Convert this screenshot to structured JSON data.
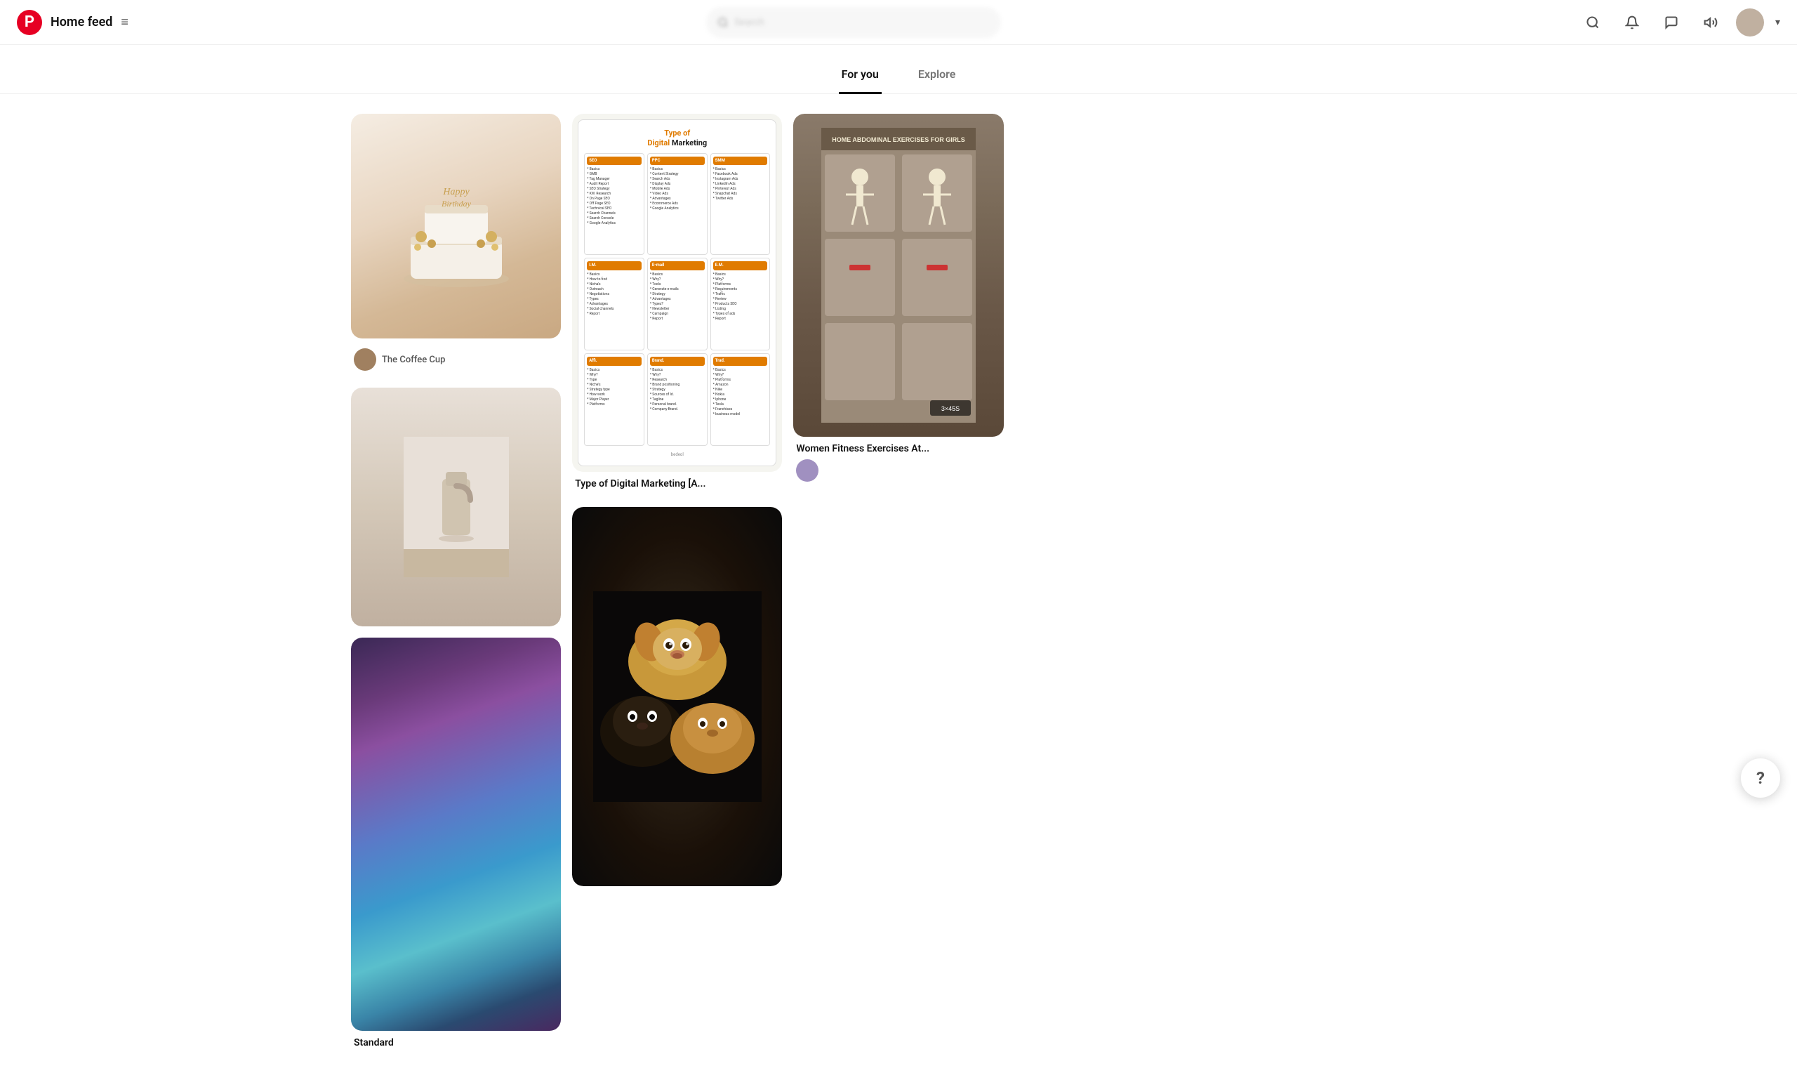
{
  "header": {
    "logo_symbol": "P",
    "title": "Home feed",
    "hamburger": "≡",
    "search_placeholder": "Search",
    "icons": [
      "search",
      "bell",
      "chat",
      "megaphone"
    ],
    "chevron": "▾"
  },
  "tabs": {
    "items": [
      {
        "id": "for-you",
        "label": "For you",
        "active": true
      },
      {
        "id": "explore",
        "label": "Explore",
        "active": false
      }
    ]
  },
  "pins": [
    {
      "id": "cake",
      "title": "",
      "user_name": "The Coffee Cup",
      "has_user": true,
      "col": 0
    },
    {
      "id": "abstract",
      "title": "Standard",
      "user_name": "",
      "has_user": false,
      "col": 1
    },
    {
      "id": "digital-marketing",
      "title": "Type of Digital Marketing [A...",
      "user_name": "",
      "has_user": false,
      "col": 2
    },
    {
      "id": "puppies",
      "title": "",
      "user_name": "",
      "has_user": false,
      "col": 3
    },
    {
      "id": "fitness",
      "title": "Women Fitness Exercises At...",
      "user_name": "",
      "has_user": true,
      "col": 4
    },
    {
      "id": "interior",
      "title": "",
      "user_name": "",
      "has_user": false,
      "col": 0
    }
  ],
  "digital_marketing": {
    "title_line1": "Type of",
    "title_highlight": "Digital",
    "title_line2": "Marketing",
    "cells": [
      {
        "header": "SEO",
        "items": [
          "Basics",
          "GMB",
          "Tag Manager",
          "Audit Report",
          "SEO Strategy",
          "KW. Research",
          "On Page SEO",
          "Off Page SEO",
          "Technical SEO",
          "Search Channels",
          "Search Console",
          "Google Analytics"
        ]
      },
      {
        "header": "PPC",
        "items": [
          "Basics",
          "Content Strategy",
          "Search Ads",
          "Display Ads",
          "Mobile Ads",
          "Video Ads",
          "Advantages",
          "Ecommerce Ads",
          "Google Analytics"
        ]
      },
      {
        "header": "SMM",
        "items": [
          "Basics",
          "Facebook Ads",
          "Instagram Ads",
          "LinkedIn Ads",
          "Pinterest Ads",
          "Snapchat Ads",
          "Twitter Ads"
        ]
      },
      {
        "header": "I.M.",
        "items": [
          "Basics",
          "How to find",
          "Nicha's",
          "Outreach",
          "Negotiations",
          "Types",
          "Advantages",
          "Social channels",
          "Report"
        ]
      },
      {
        "header": "E-mail",
        "items": [
          "Basics",
          "Why?",
          "Tools",
          "Generate e-mails",
          "Strategy",
          "Advantages",
          "Types?",
          "Newsletter",
          "Campaign",
          "Report"
        ]
      },
      {
        "header": "E.M.",
        "items": [
          "Basics",
          "Why?",
          "Platforms",
          "Requirements",
          "Traffic",
          "Review",
          "Products SEO",
          "Listing",
          "Types of ads",
          "Report"
        ]
      },
      {
        "header": "Affi.",
        "items": [
          "Basics",
          "Why?",
          "Type",
          "Niche's",
          "Strategy type",
          "How work",
          "Major Player",
          "Platforms"
        ]
      },
      {
        "header": "Brand.",
        "items": [
          "Basics",
          "Why?",
          "Research",
          "Brand positioning",
          "Strategy",
          "Sources of Id.",
          "Tagline",
          "Personal brand.",
          "Company Brand."
        ]
      },
      {
        "header": "Trad.",
        "items": [
          "Basics",
          "Why?",
          "Platforms",
          "Amazon",
          "Nike",
          "Nokia",
          "Iphone",
          "Tesla",
          "Franchises",
          "business model"
        ]
      }
    ],
    "footer": "bedeol"
  },
  "fitness": {
    "badge": "3×45S"
  },
  "help_button": "?"
}
